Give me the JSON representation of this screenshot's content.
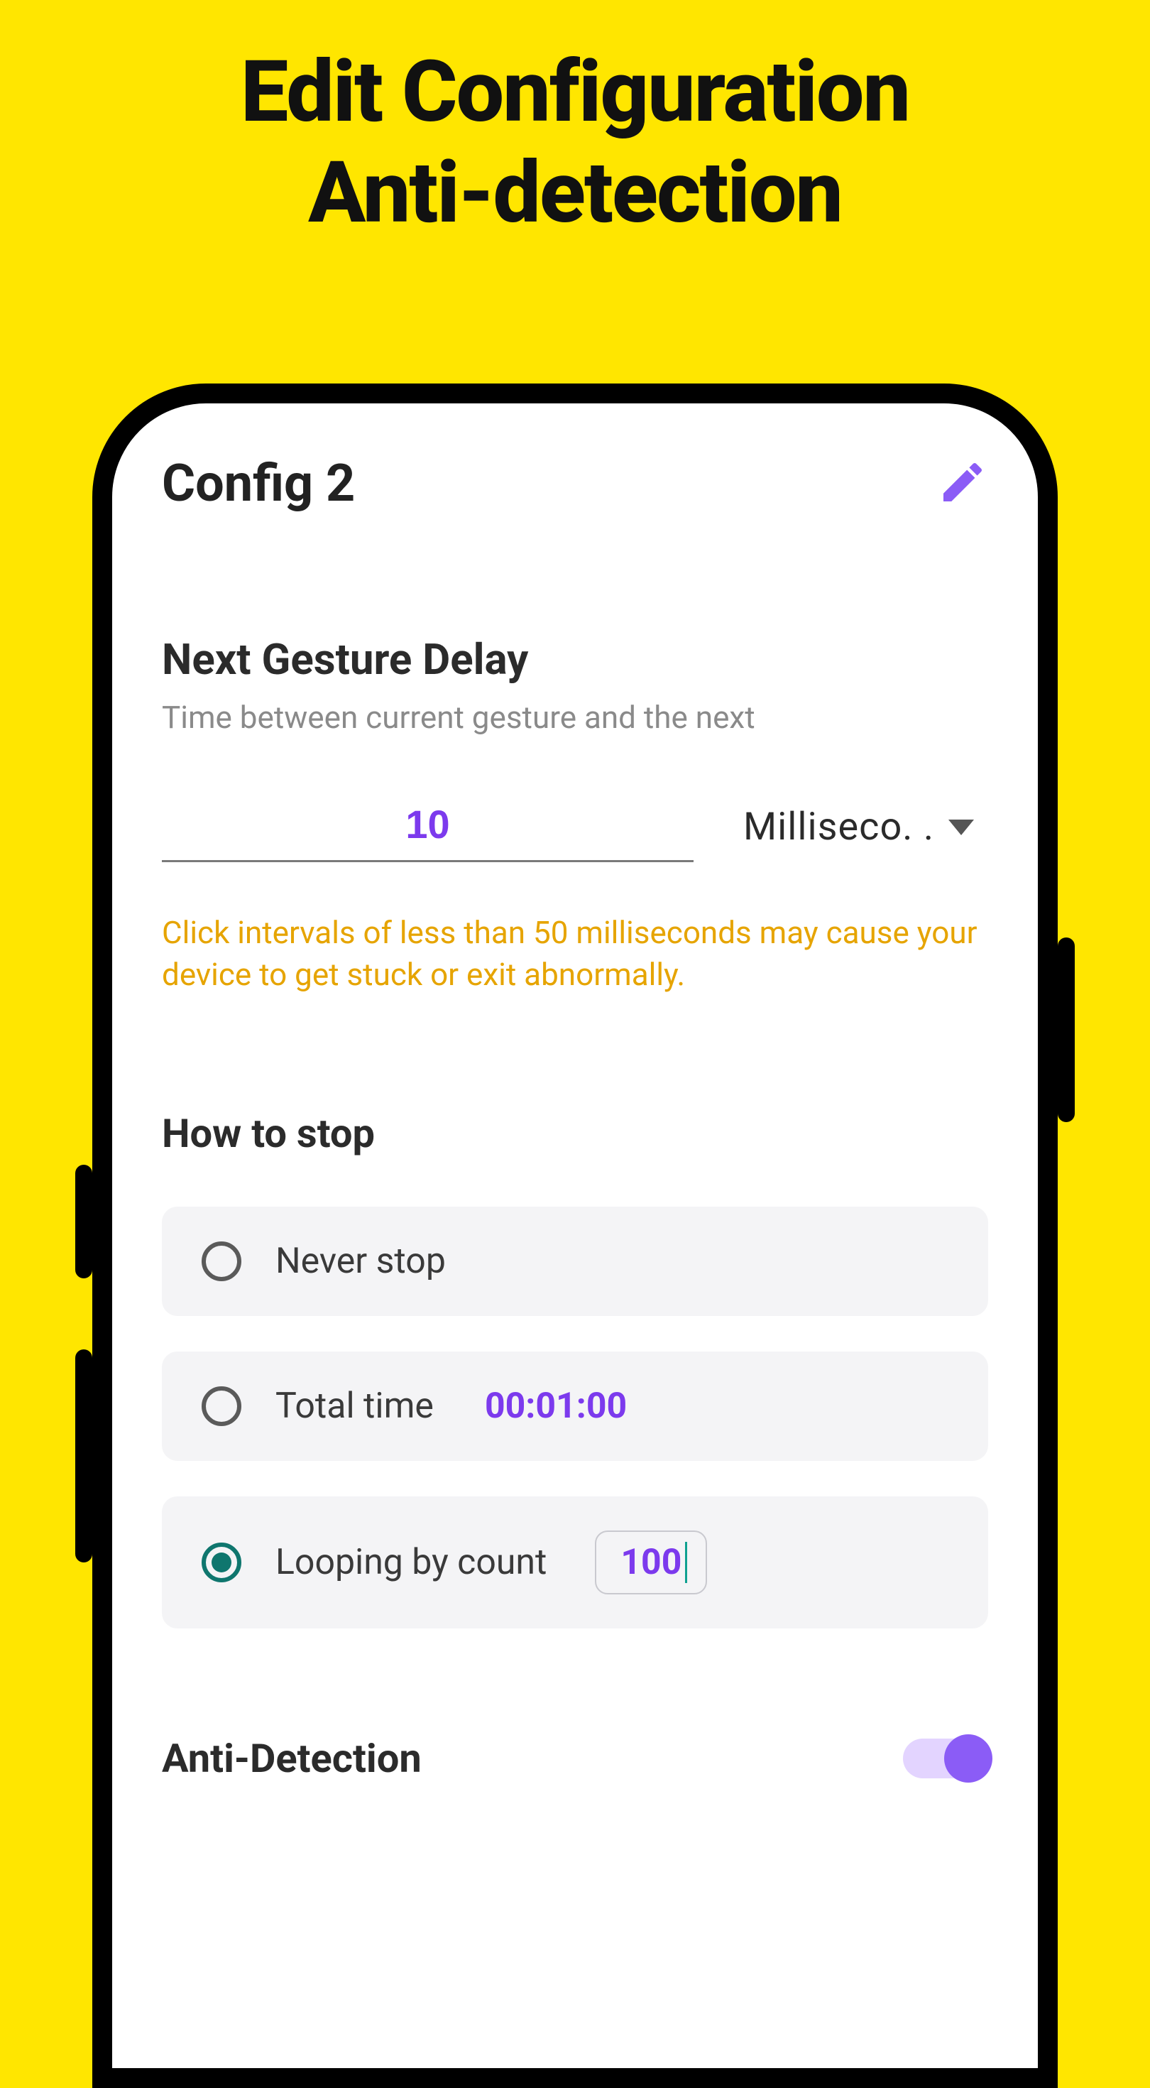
{
  "promo": {
    "line1": "Edit Configuration",
    "line2": "Anti-detection"
  },
  "header": {
    "title": "Config 2"
  },
  "delay": {
    "section_title": "Next Gesture Delay",
    "subtitle": "Time between current gesture and the next",
    "value": "10",
    "unit_display": "Milliseco. .",
    "warning": "Click intervals of less than 50 milliseconds may cause your device to get stuck or exit abnormally."
  },
  "stop": {
    "section_title": "How to stop",
    "options": {
      "never": {
        "label": "Never stop",
        "selected": false
      },
      "total_time": {
        "label": "Total time",
        "value": "00:01:00",
        "selected": false
      },
      "loop_count": {
        "label": "Looping by count",
        "value": "100",
        "selected": true
      }
    }
  },
  "anti_detection": {
    "label": "Anti-Detection",
    "enabled": true
  },
  "colors": {
    "accent_purple": "#8b5cf6",
    "accent_teal": "#0f766e",
    "warning_orange": "#e6a400",
    "bg_yellow": "#ffe600"
  }
}
